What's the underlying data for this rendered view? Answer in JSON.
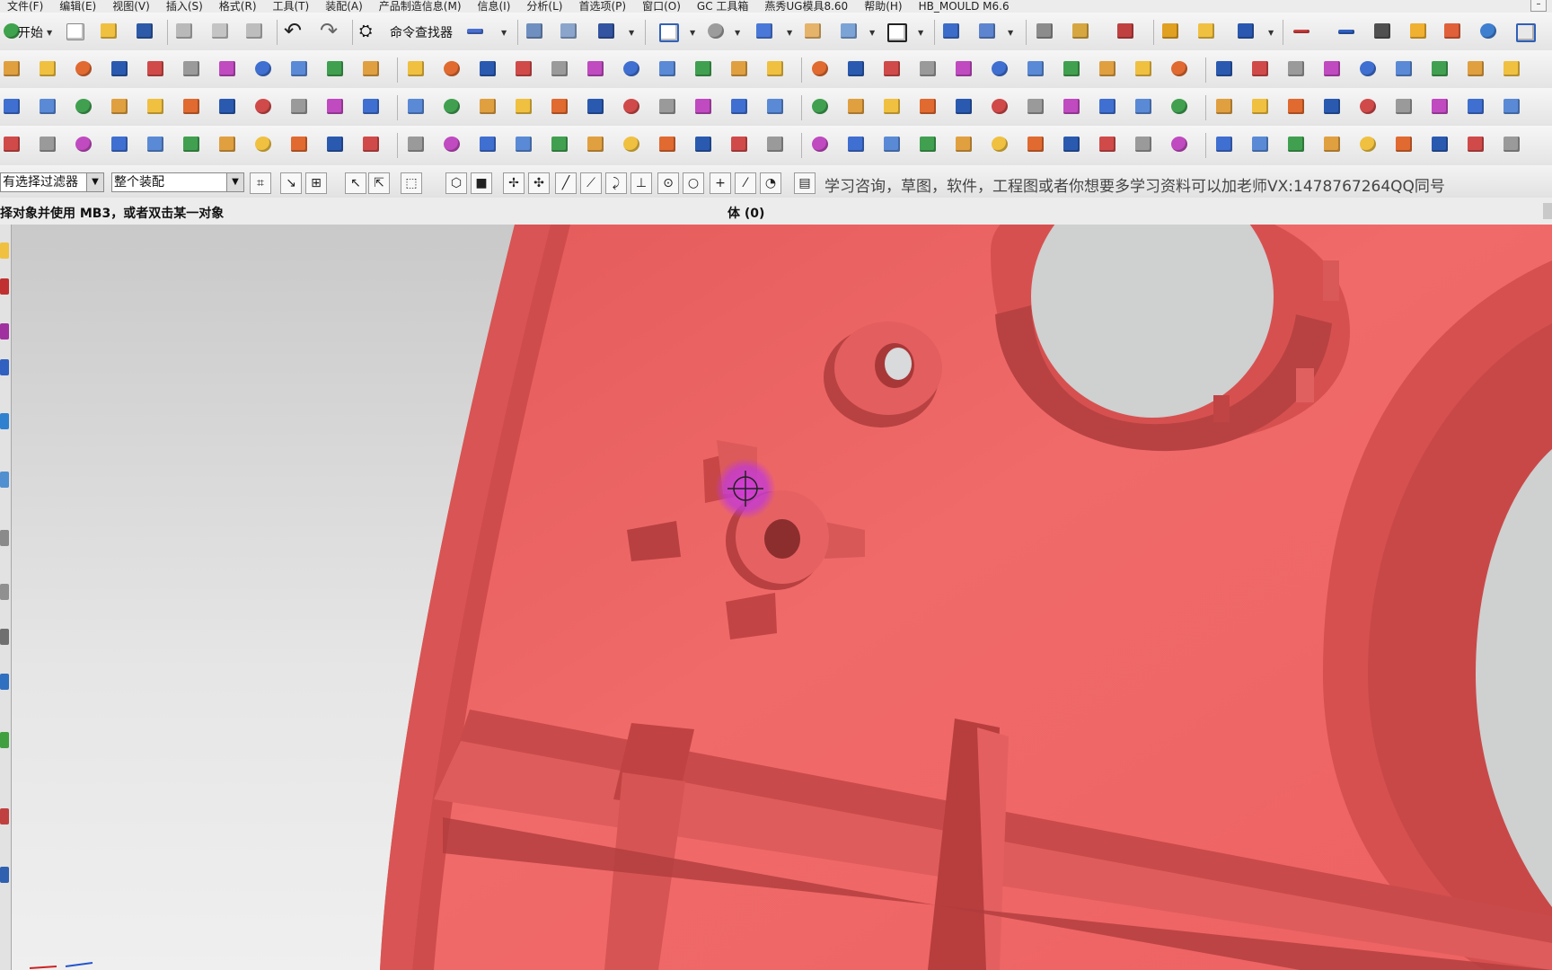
{
  "menu": {
    "items": [
      "文件(F)",
      "编辑(E)",
      "视图(V)",
      "插入(S)",
      "格式(R)",
      "工具(T)",
      "装配(A)",
      "产品制造信息(M)",
      "信息(I)",
      "分析(L)",
      "首选项(P)",
      "窗口(O)",
      "GC 工具箱",
      "燕秀UG模具8.60",
      "帮助(H)",
      "HB_MOULD M6.6"
    ]
  },
  "toolbar": {
    "start_label": "开始",
    "command_finder_label": "命令查找器"
  },
  "selection_bar": {
    "filter_value": "有选择过滤器",
    "scope_value": "整个装配",
    "promo_text": "学习咨询，草图，软件，工程图或者你想要多学习资料可以加老师VX:1478767264QQ同号"
  },
  "status": {
    "prompt": "择对象并使用 MB3，或者双击某一对象",
    "selection_info": "体 (0)"
  },
  "colors": {
    "model_fill": "#ef6464",
    "model_shadow": "#c94848",
    "cursor_highlight": "#c23ad6"
  },
  "icons": {
    "cursor": "crosshair-icon"
  }
}
